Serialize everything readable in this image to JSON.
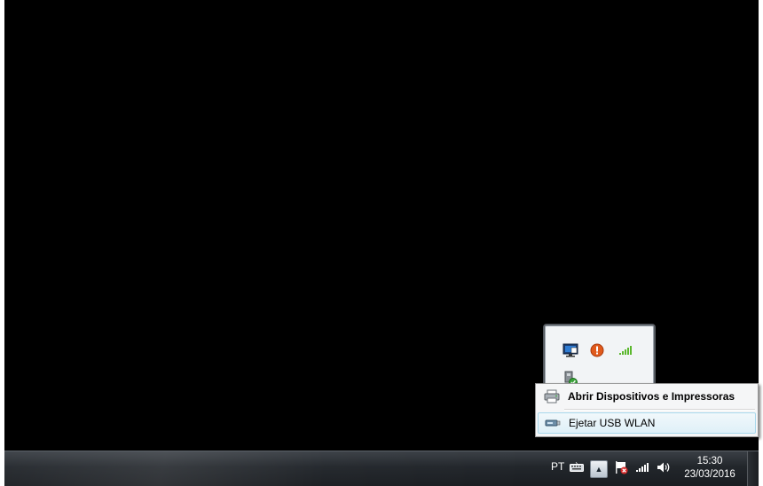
{
  "taskbar": {
    "language": "PT",
    "clock_time": "15:30",
    "clock_date": "23/03/2016",
    "show_hidden_glyph": "▲",
    "tray_icons": [
      "keyboard-icon",
      "flag-icon",
      "signal-icon",
      "volume-icon"
    ]
  },
  "tray_popup": {
    "icons": [
      "monitor-icon",
      "warning-icon",
      "signal-icon",
      "usb-device-icon"
    ]
  },
  "context_menu": {
    "items": [
      {
        "label": "Abrir Dispositivos e Impressoras",
        "icon": "printer-icon",
        "bold": true
      },
      {
        "label": "Ejetar USB WLAN",
        "icon": "usb-device-icon",
        "bold": false,
        "highlighted": true
      }
    ]
  },
  "colors": {
    "desktop": "#000000",
    "warning": "#e05a1c",
    "signal": "#5cb82e",
    "menu_highlight": "#dff0f8"
  }
}
